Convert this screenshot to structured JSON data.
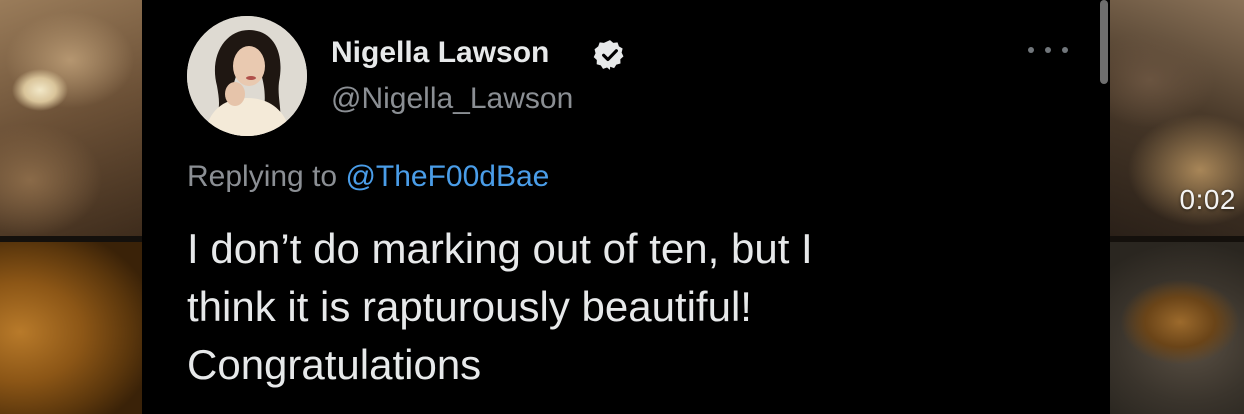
{
  "media": {
    "video_duration": "0:02"
  },
  "tweet": {
    "author": {
      "display_name": "Nigella Lawson",
      "handle": "@Nigella_Lawson",
      "verified": true
    },
    "replying_to_label": "Replying to",
    "replying_to_handle": "@TheF00dBae",
    "text_lines": [
      "I don’t do marking out of ten, but I",
      "think it is rapturously beautiful!",
      "Congratulations"
    ]
  },
  "icons": {
    "verified": "verified-badge-icon",
    "more": "more-options-icon"
  },
  "colors": {
    "background": "#000000",
    "text_primary": "#e7e9ea",
    "text_secondary": "#8b8f94",
    "link": "#4a9de8"
  }
}
